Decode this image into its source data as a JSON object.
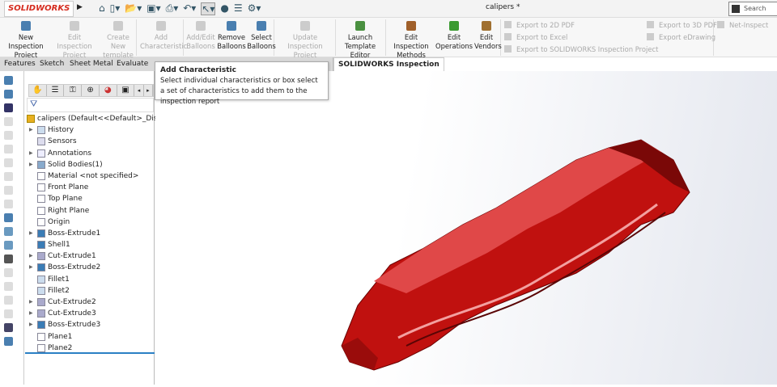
{
  "app": {
    "logo": "SOLIDWORKS",
    "document_title": "calipers *",
    "search_placeholder": "Search Com"
  },
  "ribbon": {
    "buttons": [
      {
        "label1": "New Inspection",
        "label2": "Project",
        "enabled": true
      },
      {
        "label1": "Edit Inspection",
        "label2": "Project",
        "enabled": false
      },
      {
        "label1": "Create New",
        "label2": "template",
        "enabled": false
      },
      {
        "label1": "Add",
        "label2": "Characteristic",
        "enabled": false
      },
      {
        "label1": "Add/Edit",
        "label2": "Balloons",
        "enabled": false
      },
      {
        "label1": "Remove",
        "label2": "Balloons",
        "enabled": true
      },
      {
        "label1": "Select",
        "label2": "Balloons",
        "enabled": true
      },
      {
        "label1": "Update Inspection",
        "label2": "Project",
        "enabled": false
      },
      {
        "label1": "Launch",
        "label2": "Template Editor",
        "enabled": true
      },
      {
        "label1": "Edit Inspection",
        "label2": "Methods",
        "enabled": true
      },
      {
        "label1": "Edit",
        "label2": "Operations",
        "enabled": true
      },
      {
        "label1": "Edit",
        "label2": "Vendors",
        "enabled": true
      }
    ],
    "exports": [
      "Export to 2D PDF",
      "Export to Excel",
      "Export to SOLIDWORKS Inspection Project",
      "Export to 3D PDF",
      "Export eDrawing",
      "Net-Inspect"
    ]
  },
  "tabs": [
    "Features",
    "Sketch",
    "Sheet Metal",
    "Evaluate",
    "SOLIDWORKS Inspection"
  ],
  "tooltip": {
    "title": "Add Characteristic",
    "body": "Select individual characteristics or box select a set of characteristics to add them to the inspection report"
  },
  "tree": {
    "root": "calipers  (Default<<Default>_Display",
    "items": [
      "History",
      "Sensors",
      "Annotations",
      "Solid Bodies(1)",
      "Material <not specified>",
      "Front Plane",
      "Top Plane",
      "Right Plane",
      "Origin",
      "Boss-Extrude1",
      "Shell1",
      "Cut-Extrude1",
      "Boss-Extrude2",
      "Fillet1",
      "Fillet2",
      "Cut-Extrude2",
      "Cut-Extrude3",
      "Boss-Extrude3",
      "Plane1",
      "Plane2"
    ],
    "expandable": [
      true,
      false,
      true,
      true,
      false,
      false,
      false,
      false,
      false,
      true,
      false,
      true,
      true,
      false,
      false,
      true,
      true,
      true,
      false,
      false
    ]
  },
  "colors": {
    "model": "#c0110f",
    "accent": "#2a7fc4",
    "brand": "#d52b1e"
  }
}
